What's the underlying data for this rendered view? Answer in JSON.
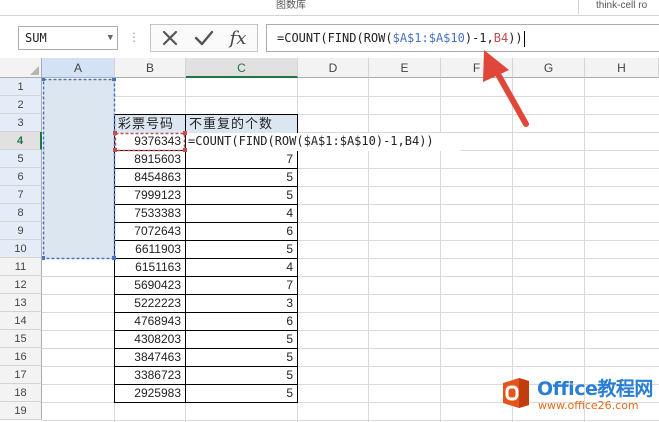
{
  "ribbon": {
    "group_label": "图数库",
    "addin_label": "think-cell ro"
  },
  "formula_bar": {
    "name_box": "SUM",
    "formula": {
      "prefix": "=COUNT(FIND(ROW(",
      "ref1": "$A$1:$A$10",
      "mid": ")-1,",
      "ref2": "B4",
      "suffix": "))"
    },
    "icons": {
      "cancel": "close-icon",
      "enter": "check-icon",
      "insert_function": "fx-icon"
    }
  },
  "sheet": {
    "columns": [
      "A",
      "B",
      "C",
      "D",
      "E",
      "F",
      "G",
      "H"
    ],
    "active_column": "C",
    "active_row": "4",
    "rows": [
      "1",
      "2",
      "3",
      "4",
      "5",
      "6",
      "7",
      "8",
      "9",
      "10",
      "11",
      "12",
      "13",
      "14",
      "15",
      "16",
      "17",
      "18",
      "19"
    ],
    "header_row": {
      "b3": "彩票号码",
      "c3": "不重复的个数"
    },
    "editing_cell": {
      "b4": "9376343",
      "c4": "=COUNT(FIND(ROW($A$1:$A$10)-1,B4))"
    },
    "data_rows": [
      {
        "b": "8915603",
        "c": "7"
      },
      {
        "b": "8454863",
        "c": "5"
      },
      {
        "b": "7999123",
        "c": "5"
      },
      {
        "b": "7533383",
        "c": "4"
      },
      {
        "b": "7072643",
        "c": "6"
      },
      {
        "b": "6611903",
        "c": "5"
      },
      {
        "b": "6151163",
        "c": "4"
      },
      {
        "b": "5690423",
        "c": "7"
      },
      {
        "b": "5222223",
        "c": "3"
      },
      {
        "b": "4768943",
        "c": "6"
      },
      {
        "b": "4308203",
        "c": "5"
      },
      {
        "b": "3847463",
        "c": "5"
      },
      {
        "b": "3386723",
        "c": "5"
      },
      {
        "b": "2925983",
        "c": "5"
      }
    ]
  },
  "watermark": {
    "brand": "Office教程网",
    "url": "www.office26.com"
  },
  "colors": {
    "excel_green": "#217346",
    "ref_blue": "#4472c4",
    "ref_red": "#c0504d",
    "arrow_red": "#e0463a",
    "selection_fill": "#dce6f1"
  }
}
